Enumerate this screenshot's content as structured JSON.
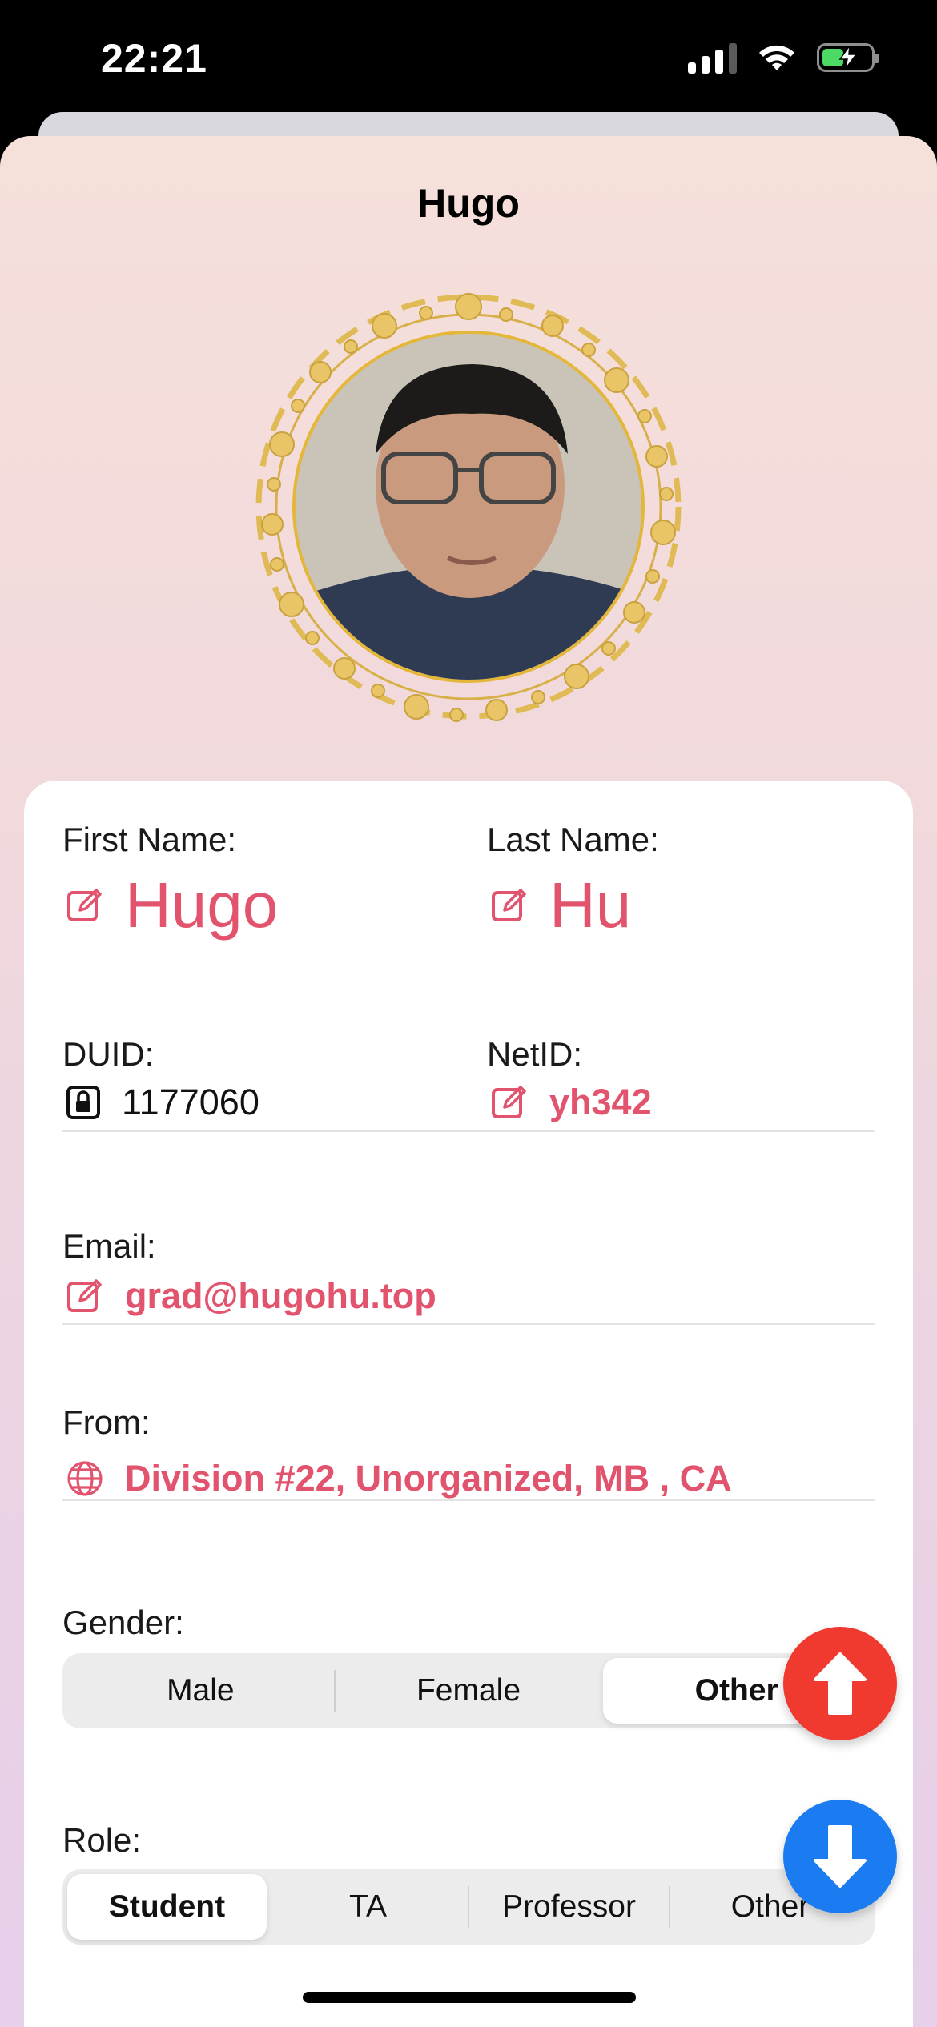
{
  "status_bar": {
    "time": "22:21"
  },
  "header": {
    "title": "Hugo"
  },
  "profile": {
    "first_name_label": "First Name:",
    "first_name": "Hugo",
    "last_name_label": "Last Name:",
    "last_name": "Hu",
    "duid_label": "DUID:",
    "duid": "1177060",
    "netid_label": "NetID:",
    "netid": "yh342",
    "email_label": "Email:",
    "email": "grad@hugohu.top",
    "from_label": "From:",
    "from": "Division #22, Unorganized, MB , CA"
  },
  "gender": {
    "label": "Gender:",
    "options": [
      "Male",
      "Female",
      "Other"
    ],
    "selected": "Other"
  },
  "role": {
    "label": "Role:",
    "options": [
      "Student",
      "TA",
      "Professor",
      "Other"
    ],
    "selected": "Student"
  },
  "icons": {
    "edit": "square-and-pencil-icon",
    "lock": "lock-icon",
    "globe": "globe-icon",
    "scroll_up": "arrow-up-icon",
    "scroll_down": "arrow-down-icon"
  },
  "colors": {
    "accent": "#e2546e",
    "scroll_up_button": "#f0392f",
    "scroll_down_button": "#1b7cf2",
    "battery": "#4cd964"
  }
}
